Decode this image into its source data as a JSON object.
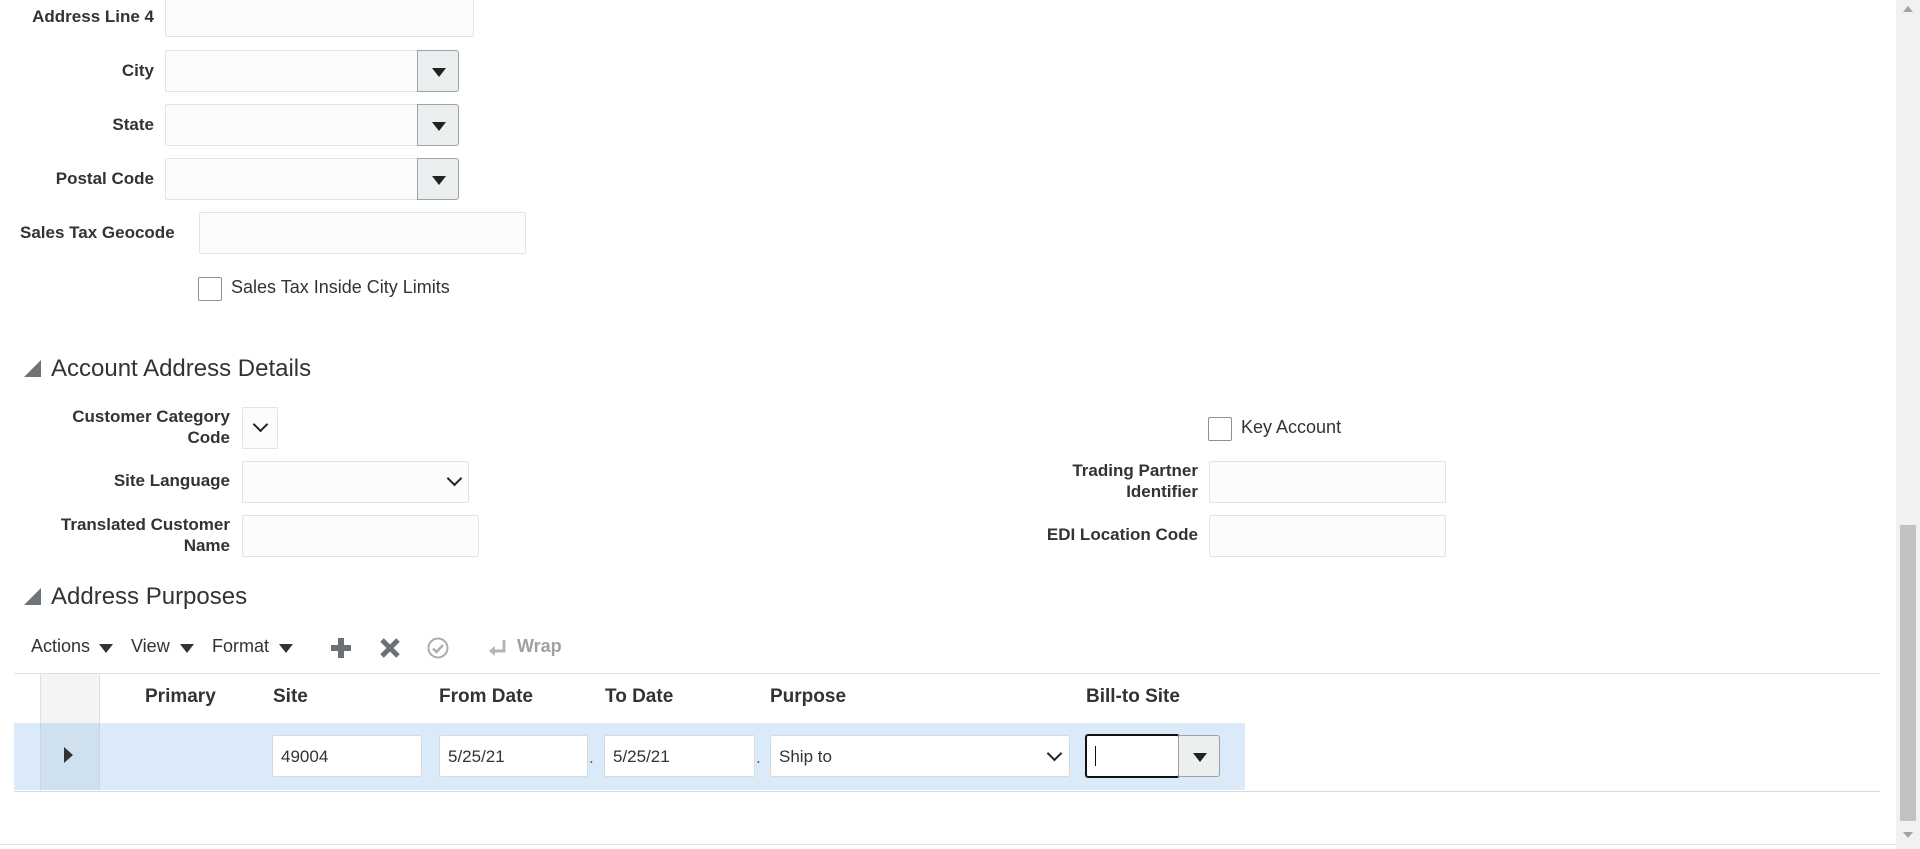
{
  "customer_address": {
    "address_line_4_label": "Address Line 4",
    "city_label": "City",
    "state_label": "State",
    "postal_code_label": "Postal Code",
    "sales_tax_geocode_label": "Sales Tax Geocode",
    "sales_tax_inside_city_limits_label": "Sales Tax Inside City Limits"
  },
  "account_address_details": {
    "title": "Account Address Details",
    "customer_category_code_label_1": "Customer Category",
    "customer_category_code_label_2": "Code",
    "site_language_label": "Site Language",
    "translated_customer_name_label_1": "Translated Customer",
    "translated_customer_name_label_2": "Name",
    "key_account_label": "Key Account",
    "trading_partner_identifier_label_1": "Trading Partner",
    "trading_partner_identifier_label_2": "Identifier",
    "edi_location_code_label": "EDI Location Code"
  },
  "address_purposes": {
    "title": "Address Purposes",
    "toolbar": {
      "actions_label": "Actions",
      "view_label": "View",
      "format_label": "Format",
      "wrap_label": "Wrap"
    },
    "columns": [
      "Primary",
      "Site",
      "From Date",
      "To Date",
      "Purpose",
      "Bill-to Site"
    ],
    "rows": [
      {
        "primary": "",
        "site": "49004",
        "from_date": "5/25/21",
        "to_date": "5/25/21",
        "purpose": "Ship to",
        "bill_to_site": ""
      }
    ]
  },
  "colors": {
    "selected_row": "#dbeaf8",
    "field_border": "#dfe4e7"
  }
}
